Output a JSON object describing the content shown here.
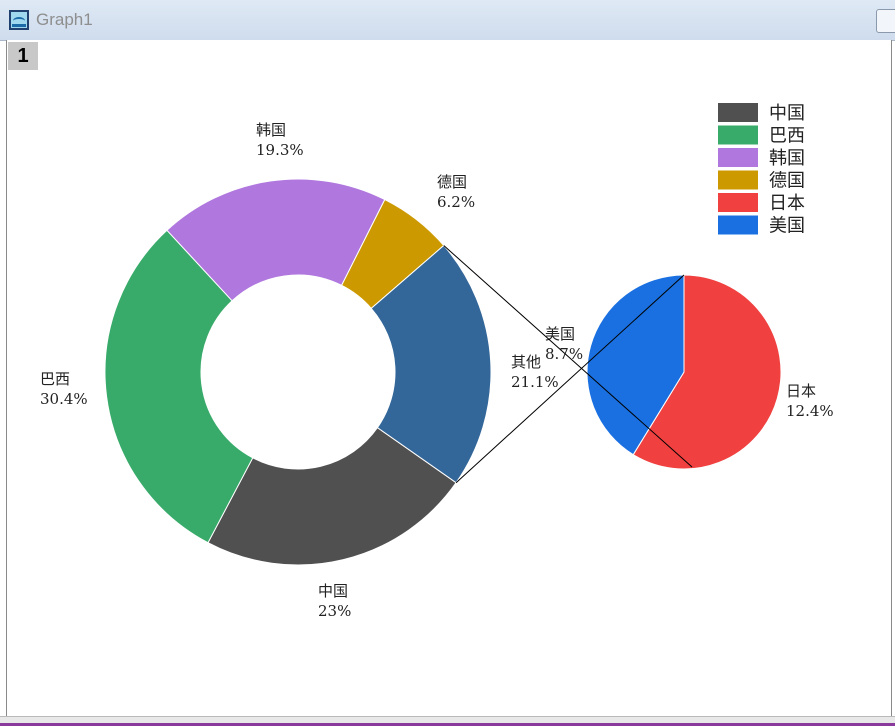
{
  "window": {
    "title": "Graph1",
    "layer_label": "1"
  },
  "chart_data": {
    "type": "pie",
    "subtype": "bar-of-pie (doughnut with exploded pie)",
    "main_ring": [
      {
        "name": "中国",
        "percent_label": "23%",
        "value": 23.0,
        "color": "#505050"
      },
      {
        "name": "巴西",
        "percent_label": "30.4%",
        "value": 30.4,
        "color": "#38ab6a"
      },
      {
        "name": "韩国",
        "percent_label": "19.3%",
        "value": 19.3,
        "color": "#b078de"
      },
      {
        "name": "德国",
        "percent_label": "6.2%",
        "value": 6.2,
        "color": "#cc9900"
      },
      {
        "name": "其他",
        "percent_label": "21.1%",
        "value": 21.1,
        "color": "#336699"
      }
    ],
    "detail_pie": [
      {
        "name": "日本",
        "percent_label": "12.4%",
        "value": 12.4,
        "color": "#f04040"
      },
      {
        "name": "美国",
        "percent_label": "8.7%",
        "value": 8.7,
        "color": "#1a70e0"
      }
    ],
    "legend": {
      "placement": "top-right",
      "items": [
        {
          "label": "中国",
          "color": "#505050"
        },
        {
          "label": "巴西",
          "color": "#38ab6a"
        },
        {
          "label": "韩国",
          "color": "#b078de"
        },
        {
          "label": "德国",
          "color": "#cc9900"
        },
        {
          "label": "日本",
          "color": "#f04040"
        },
        {
          "label": "美国",
          "color": "#1a70e0"
        }
      ]
    }
  }
}
